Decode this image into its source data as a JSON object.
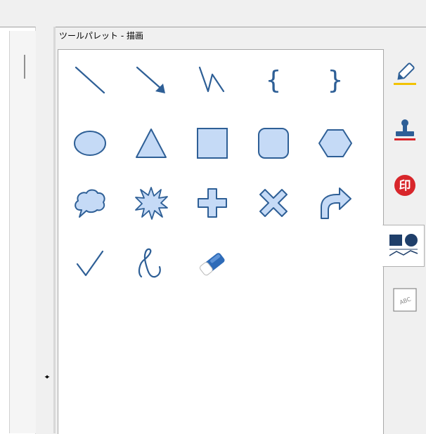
{
  "palette": {
    "title": "ツールパレット - 描画",
    "splitter_grip": "◂▸"
  },
  "tools": [
    {
      "name": "line-tool",
      "icon": "line-icon"
    },
    {
      "name": "arrow-tool",
      "icon": "arrow-icon"
    },
    {
      "name": "polyline-tool",
      "icon": "polyline-icon"
    },
    {
      "name": "left-brace-tool",
      "icon": "left-brace-icon",
      "glyph": "{"
    },
    {
      "name": "right-brace-tool",
      "icon": "right-brace-icon",
      "glyph": "}"
    },
    {
      "name": "ellipse-tool",
      "icon": "ellipse-icon"
    },
    {
      "name": "triangle-tool",
      "icon": "triangle-icon"
    },
    {
      "name": "rectangle-tool",
      "icon": "rectangle-icon"
    },
    {
      "name": "rounded-rectangle-tool",
      "icon": "rounded-rectangle-icon"
    },
    {
      "name": "hexagon-tool",
      "icon": "hexagon-icon"
    },
    {
      "name": "cloud-callout-tool",
      "icon": "cloud-callout-icon"
    },
    {
      "name": "explosion-tool",
      "icon": "explosion-icon"
    },
    {
      "name": "plus-tool",
      "icon": "plus-icon"
    },
    {
      "name": "cross-tool",
      "icon": "cross-icon"
    },
    {
      "name": "curved-arrow-tool",
      "icon": "curved-arrow-icon"
    },
    {
      "name": "checkmark-tool",
      "icon": "checkmark-icon"
    },
    {
      "name": "freehand-tool",
      "icon": "freehand-loop-icon"
    },
    {
      "name": "eraser-tool",
      "icon": "eraser-icon"
    }
  ],
  "side_tabs": [
    {
      "name": "highlighter-tab",
      "icon": "highlighter-icon"
    },
    {
      "name": "stamp-tab",
      "icon": "stamp-icon"
    },
    {
      "name": "seal-tab",
      "icon": "seal-icon",
      "glyph": "印"
    },
    {
      "name": "drawing-tab",
      "icon": "shapes-icon",
      "active": true
    },
    {
      "name": "text-tab",
      "icon": "text-box-icon",
      "glyph": "ABC"
    }
  ],
  "colors": {
    "icon_stroke": "#2e5f96",
    "icon_fill": "#c5daf6",
    "highlighter_yellow": "#f2c200",
    "stamp_red": "#d8262b"
  }
}
